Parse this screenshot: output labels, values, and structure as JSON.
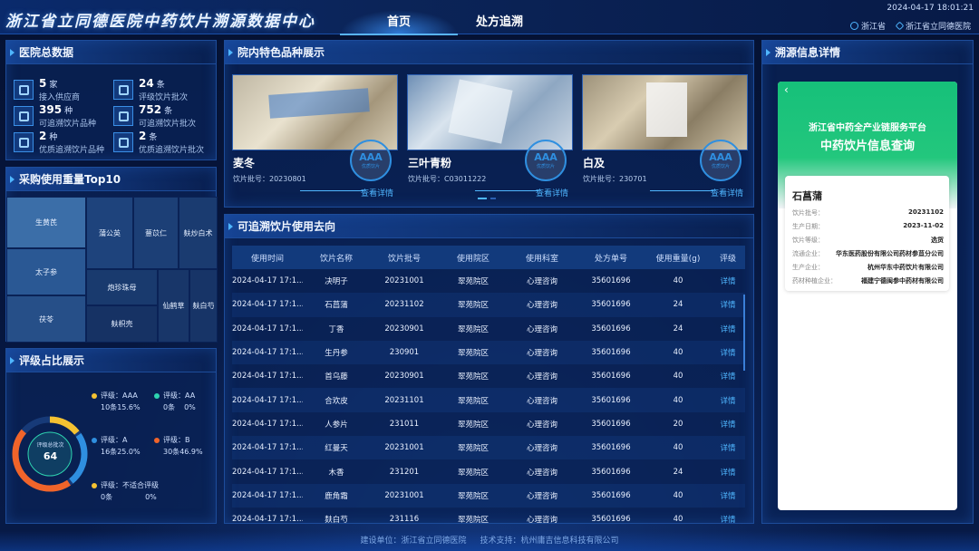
{
  "header": {
    "title": "浙江省立同德医院中药饮片溯源数据中心",
    "tabs": [
      "首页",
      "处方追溯"
    ],
    "datetime": "2024-04-17 18:01:21",
    "province": "浙江省",
    "hospital": "浙江省立同德医院"
  },
  "stats_panel": {
    "title": "医院总数据",
    "items": [
      {
        "num": "5",
        "unit": "家",
        "label": "接入供应商"
      },
      {
        "num": "24",
        "unit": "条",
        "label": "评级饮片批次"
      },
      {
        "num": "395",
        "unit": "种",
        "label": "可追溯饮片品种"
      },
      {
        "num": "752",
        "unit": "条",
        "label": "可追溯饮片批次"
      },
      {
        "num": "2",
        "unit": "种",
        "label": "优质追溯饮片品种"
      },
      {
        "num": "2",
        "unit": "条",
        "label": "优质追溯饮片批次"
      }
    ]
  },
  "top10_panel": {
    "title": "采购使用重量Top10",
    "items": [
      "生黄芪",
      "太子参",
      "茯苓",
      "蒲公英",
      "薏苡仁",
      "麸炒白术",
      "炮珍珠母",
      "仙鹤草",
      "麸白芍",
      "麸枳壳"
    ]
  },
  "grade_panel": {
    "title": "评级占比展示",
    "center_label": "评级总批次",
    "center_value": "64",
    "legend": [
      {
        "name": "评级：AAA",
        "count": "10条",
        "pct": "15.6%",
        "color": "#f5c231"
      },
      {
        "name": "评级：AA",
        "count": "0条",
        "pct": "0%",
        "color": "#2ed3b0"
      },
      {
        "name": "评级：A",
        "count": "16条",
        "pct": "25.0%",
        "color": "#2f8fe0"
      },
      {
        "name": "评级：B",
        "count": "30条",
        "pct": "46.9%",
        "color": "#f0642a"
      },
      {
        "name": "评级：不适合评级",
        "count": "0条",
        "pct": "0%",
        "color": "#f5c231"
      }
    ]
  },
  "featured_panel": {
    "title": "院内特色品种展示",
    "cards": [
      {
        "name": "麦冬",
        "batch": "饮片批号：20230801",
        "link": "查看详情",
        "stamp": "AAA",
        "stamp_sub": "优质饮片"
      },
      {
        "name": "三叶青粉",
        "batch": "饮片批号：C03011222",
        "link": "查看详情",
        "stamp": "AAA",
        "stamp_sub": "优质饮片"
      },
      {
        "name": "白及",
        "batch": "饮片批号：230701",
        "link": "查看详情",
        "stamp": "AAA",
        "stamp_sub": "优质饮片"
      }
    ]
  },
  "usage_panel": {
    "title": "可追溯饮片使用去向",
    "columns": [
      "使用时间",
      "饮片名称",
      "饮片批号",
      "使用院区",
      "使用科室",
      "处方单号",
      "使用重量(g)",
      "评级"
    ],
    "rows": [
      [
        "2024-04-17 17:1...",
        "决明子",
        "20231001",
        "翠苑院区",
        "心理咨询",
        "35601696",
        "40",
        "详情"
      ],
      [
        "2024-04-17 17:1...",
        "石菖蒲",
        "20231102",
        "翠苑院区",
        "心理咨询",
        "35601696",
        "24",
        "详情"
      ],
      [
        "2024-04-17 17:1...",
        "丁香",
        "20230901",
        "翠苑院区",
        "心理咨询",
        "35601696",
        "24",
        "详情"
      ],
      [
        "2024-04-17 17:1...",
        "生丹参",
        "230901",
        "翠苑院区",
        "心理咨询",
        "35601696",
        "40",
        "详情"
      ],
      [
        "2024-04-17 17:1...",
        "首乌藤",
        "20230901",
        "翠苑院区",
        "心理咨询",
        "35601696",
        "40",
        "详情"
      ],
      [
        "2024-04-17 17:1...",
        "合欢皮",
        "20231101",
        "翠苑院区",
        "心理咨询",
        "35601696",
        "40",
        "详情"
      ],
      [
        "2024-04-17 17:1...",
        "人参片",
        "231011",
        "翠苑院区",
        "心理咨询",
        "35601696",
        "20",
        "详情"
      ],
      [
        "2024-04-17 17:1...",
        "红曼天",
        "20231001",
        "翠苑院区",
        "心理咨询",
        "35601696",
        "40",
        "详情"
      ],
      [
        "2024-04-17 17:1...",
        "木香",
        "231201",
        "翠苑院区",
        "心理咨询",
        "35601696",
        "24",
        "详情"
      ],
      [
        "2024-04-17 17:1...",
        "鹿角霜",
        "20231001",
        "翠苑院区",
        "心理咨询",
        "35601696",
        "40",
        "详情"
      ],
      [
        "2024-04-17 17:1...",
        "麸白芍",
        "231116",
        "翠苑院区",
        "心理咨询",
        "35601696",
        "40",
        "详情"
      ]
    ]
  },
  "detail_panel": {
    "title": "溯源信息详情",
    "platform": "浙江省中药全产业链服务平台",
    "subtitle": "中药饮片信息查询",
    "herb": "石菖蒲",
    "fields": [
      {
        "k": "饮片批号：",
        "v": "20231102"
      },
      {
        "k": "生产日期：",
        "v": "2023-11-02"
      },
      {
        "k": "饮片等级：",
        "v": "选货"
      },
      {
        "k": "流通企业：",
        "v": "华东医药股份有限公司药材参苴分公司"
      },
      {
        "k": "生产企业：",
        "v": "杭州华东中药饮片有限公司"
      },
      {
        "k": "药材种植企业：",
        "v": "福建宁德闽参中药材有限公司"
      }
    ]
  },
  "footer": {
    "builder": "建设单位：浙江省立同德医院",
    "support": "技术支持：杭州庸吉信息科技有限公司"
  }
}
